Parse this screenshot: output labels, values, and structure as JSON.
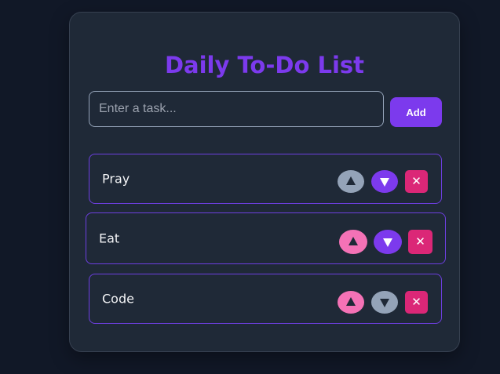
{
  "app": {
    "title": "Daily To-Do List"
  },
  "input": {
    "placeholder": "Enter a task...",
    "value": ""
  },
  "add_button": {
    "label": "Add"
  },
  "tasks": [
    {
      "label": "Pray",
      "up_enabled": false,
      "down_enabled": true
    },
    {
      "label": "Eat",
      "up_enabled": true,
      "down_enabled": true
    },
    {
      "label": "Code",
      "up_enabled": true,
      "down_enabled": false
    }
  ],
  "icons": {
    "move_up": "triangle-up-icon",
    "move_down": "triangle-down-icon",
    "delete": "close-icon",
    "delete_glyph": "✕"
  },
  "colors": {
    "background": "#111827",
    "card": "#1f2937",
    "accent": "#7c3aed",
    "up_active": "#f472b6",
    "disabled": "#94a3b8",
    "delete": "#db2777",
    "task_border": "#6d3fe0"
  }
}
